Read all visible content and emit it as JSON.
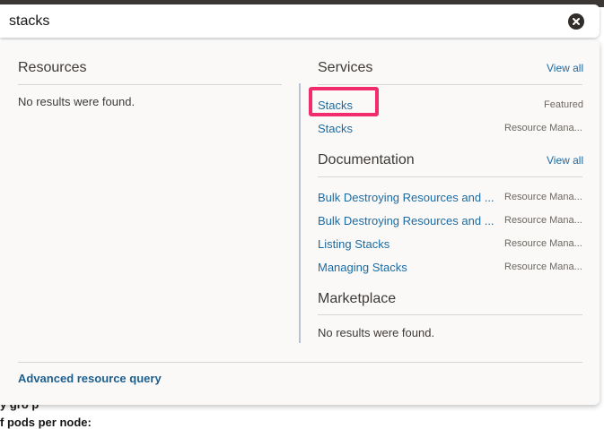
{
  "search": {
    "value": "stacks"
  },
  "resources": {
    "title": "Resources",
    "empty_text": "No results were found."
  },
  "services": {
    "title": "Services",
    "view_all": "View all",
    "items": [
      {
        "label": "Stacks",
        "category": "Featured"
      },
      {
        "label": "Stacks",
        "category": "Resource Mana..."
      }
    ]
  },
  "documentation": {
    "title": "Documentation",
    "view_all": "View all",
    "items": [
      {
        "label": "Bulk Destroying Resources and ...",
        "category": "Resource Mana..."
      },
      {
        "label": "Bulk Destroying Resources and ...",
        "category": "Resource Mana..."
      },
      {
        "label": "Listing Stacks",
        "category": "Resource Mana..."
      },
      {
        "label": "Managing Stacks",
        "category": "Resource Mana..."
      }
    ]
  },
  "marketplace": {
    "title": "Marketplace",
    "empty_text": "No results were found."
  },
  "footer": {
    "advanced_query": "Advanced resource query"
  },
  "background": {
    "line1": "y gro p",
    "line2": "f pods per node:"
  },
  "colors": {
    "link": "#1b6ba3",
    "highlight": "#f22b6d",
    "panel_bg": "#fbf9f8"
  },
  "icons": {
    "clear": "close-circle-icon"
  }
}
